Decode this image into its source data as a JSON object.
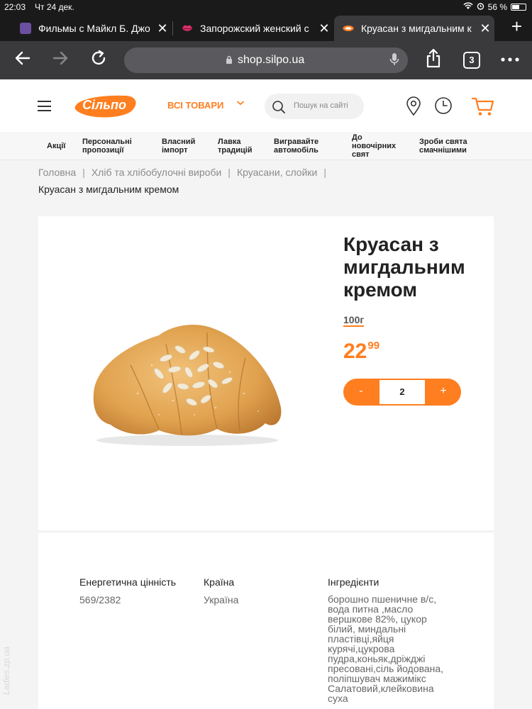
{
  "status": {
    "time": "22:03",
    "date": "Чт 24 дек.",
    "battery": "56 %",
    "battery_level": 0.56
  },
  "tabs": [
    {
      "title": "Фильмы с Майкл Б. Джо",
      "active": false
    },
    {
      "title": "Запорожский женский с",
      "active": false
    },
    {
      "title": "Круасан з мигдальним к",
      "active": true
    }
  ],
  "browser": {
    "url": "shop.silpo.ua",
    "tab_count": "3"
  },
  "header": {
    "logo_text": "Сільпо",
    "all_goods": "ВСІ ТОВАРИ",
    "search_placeholder": "Пошук на сайті"
  },
  "nav": [
    "Акції",
    "Персональні\nпропозиції",
    "Власний\nімпорт",
    "Лавка\nтрадицій",
    "Вигравайте\nавтомобіль",
    "До\nновочірних\nсвят",
    "Зроби свята\nсмачнішими"
  ],
  "breadcrumbs": [
    "Головна",
    "Хліб та хлібобулочні вироби",
    "Круасани, слойки"
  ],
  "breadcrumb_current": "Круасан з мигдальним кремом",
  "product": {
    "title": "Круасан з мигдальним кремом",
    "weight": "100г",
    "price_int": "22",
    "price_frac": "99",
    "qty_minus": "-",
    "qty_plus": "+",
    "qty_value": "2"
  },
  "info": {
    "energy_label": "Енергетична цінність",
    "energy_value": "569/2382",
    "country_label": "Країна",
    "country_value": "Україна",
    "ingredients_label": "Інгредієнти",
    "ingredients_value": "борошно пшеничне в/с, вода питна ,масло вершкове 82%, цукор білий, миндальні пластівці,яйця курячі,цукрова пудра,коньяк,дріжджі пресовані,сіль йодована, поліпшувач мажимікс Салатовий,клейковина суха"
  },
  "watermark": "Ladies.zp.ua",
  "colors": {
    "accent": "#ff7e1f",
    "dark": "#1a1a1a",
    "toolbar": "#3a3a3c"
  }
}
